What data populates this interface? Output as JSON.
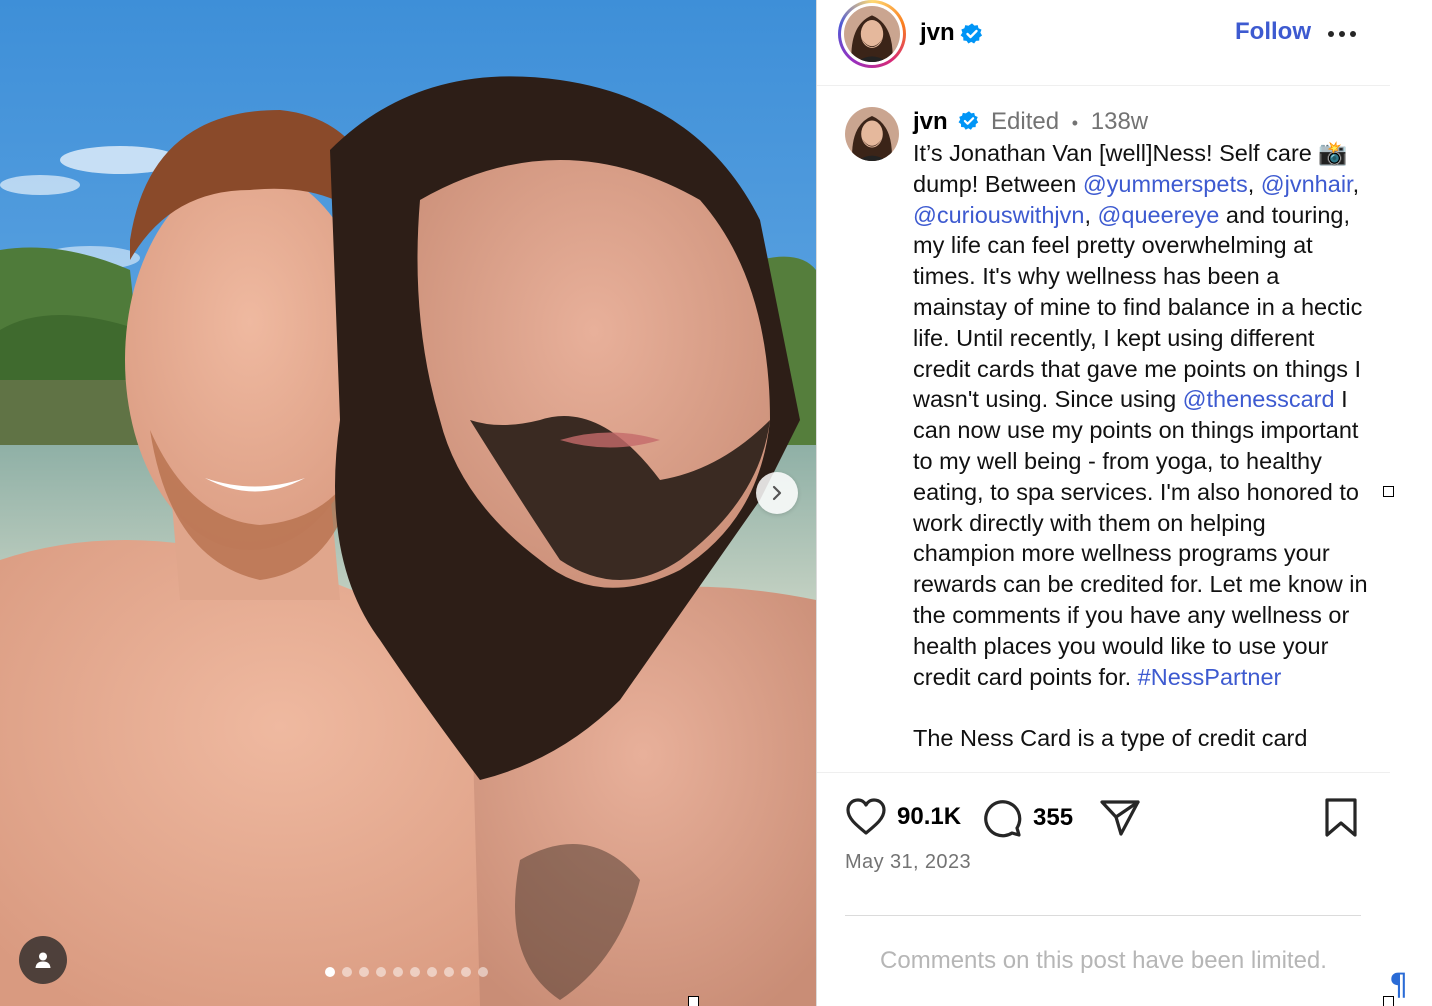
{
  "photo": {
    "carousel_count": 10,
    "active_index": 0,
    "next_icon": "chevron-right-icon",
    "tag_icon": "user-icon"
  },
  "header": {
    "username": "jvn",
    "verified": true,
    "follow_label": "Follow",
    "more_icon": "more-horizontal-icon"
  },
  "caption": {
    "username": "jvn",
    "edited": "Edited",
    "separator": "•",
    "age": "138w",
    "text": {
      "t1": "It’s Jonathan Van [well]Ness! Self care 📸 dump! Between ",
      "m1": "@yummerspets",
      "t2": ", ",
      "m2": "@jvnhair",
      "t3": ", ",
      "m3": "@curiouswithjvn",
      "t4": ", ",
      "m4": "@queereye",
      "t5": " and touring, my life can feel pretty overwhelming at times. It's why wellness has been a mainstay of mine to find balance in a hectic life. Until recently, I kept using different credit cards that gave me points on things I wasn't using. Since using ",
      "m5": "@thenesscard",
      "t6": " I can now use my points on things important to my well being - from yoga, to healthy eating, to spa services. I'm also honored to work directly with them on helping champion more wellness programs your rewards can be credited for. Let me know in the comments if you have any wellness or health places you would like to use your credit card points for. ",
      "m6": "#NessPartner",
      "p2": "The Ness Card is a type of credit card"
    }
  },
  "actions": {
    "likes": "90.1K",
    "comments": "355",
    "like_icon": "heart-icon",
    "comment_icon": "comment-icon",
    "share_icon": "send-icon",
    "save_icon": "bookmark-icon"
  },
  "date": "May 31, 2023",
  "comments_limited": "Comments on this post have been limited.",
  "editor_mark": "¶",
  "colors": {
    "link": "#3d5ad0",
    "muted": "#737373",
    "verified": "#0095f6",
    "limited_text": "#b6b6b6"
  }
}
